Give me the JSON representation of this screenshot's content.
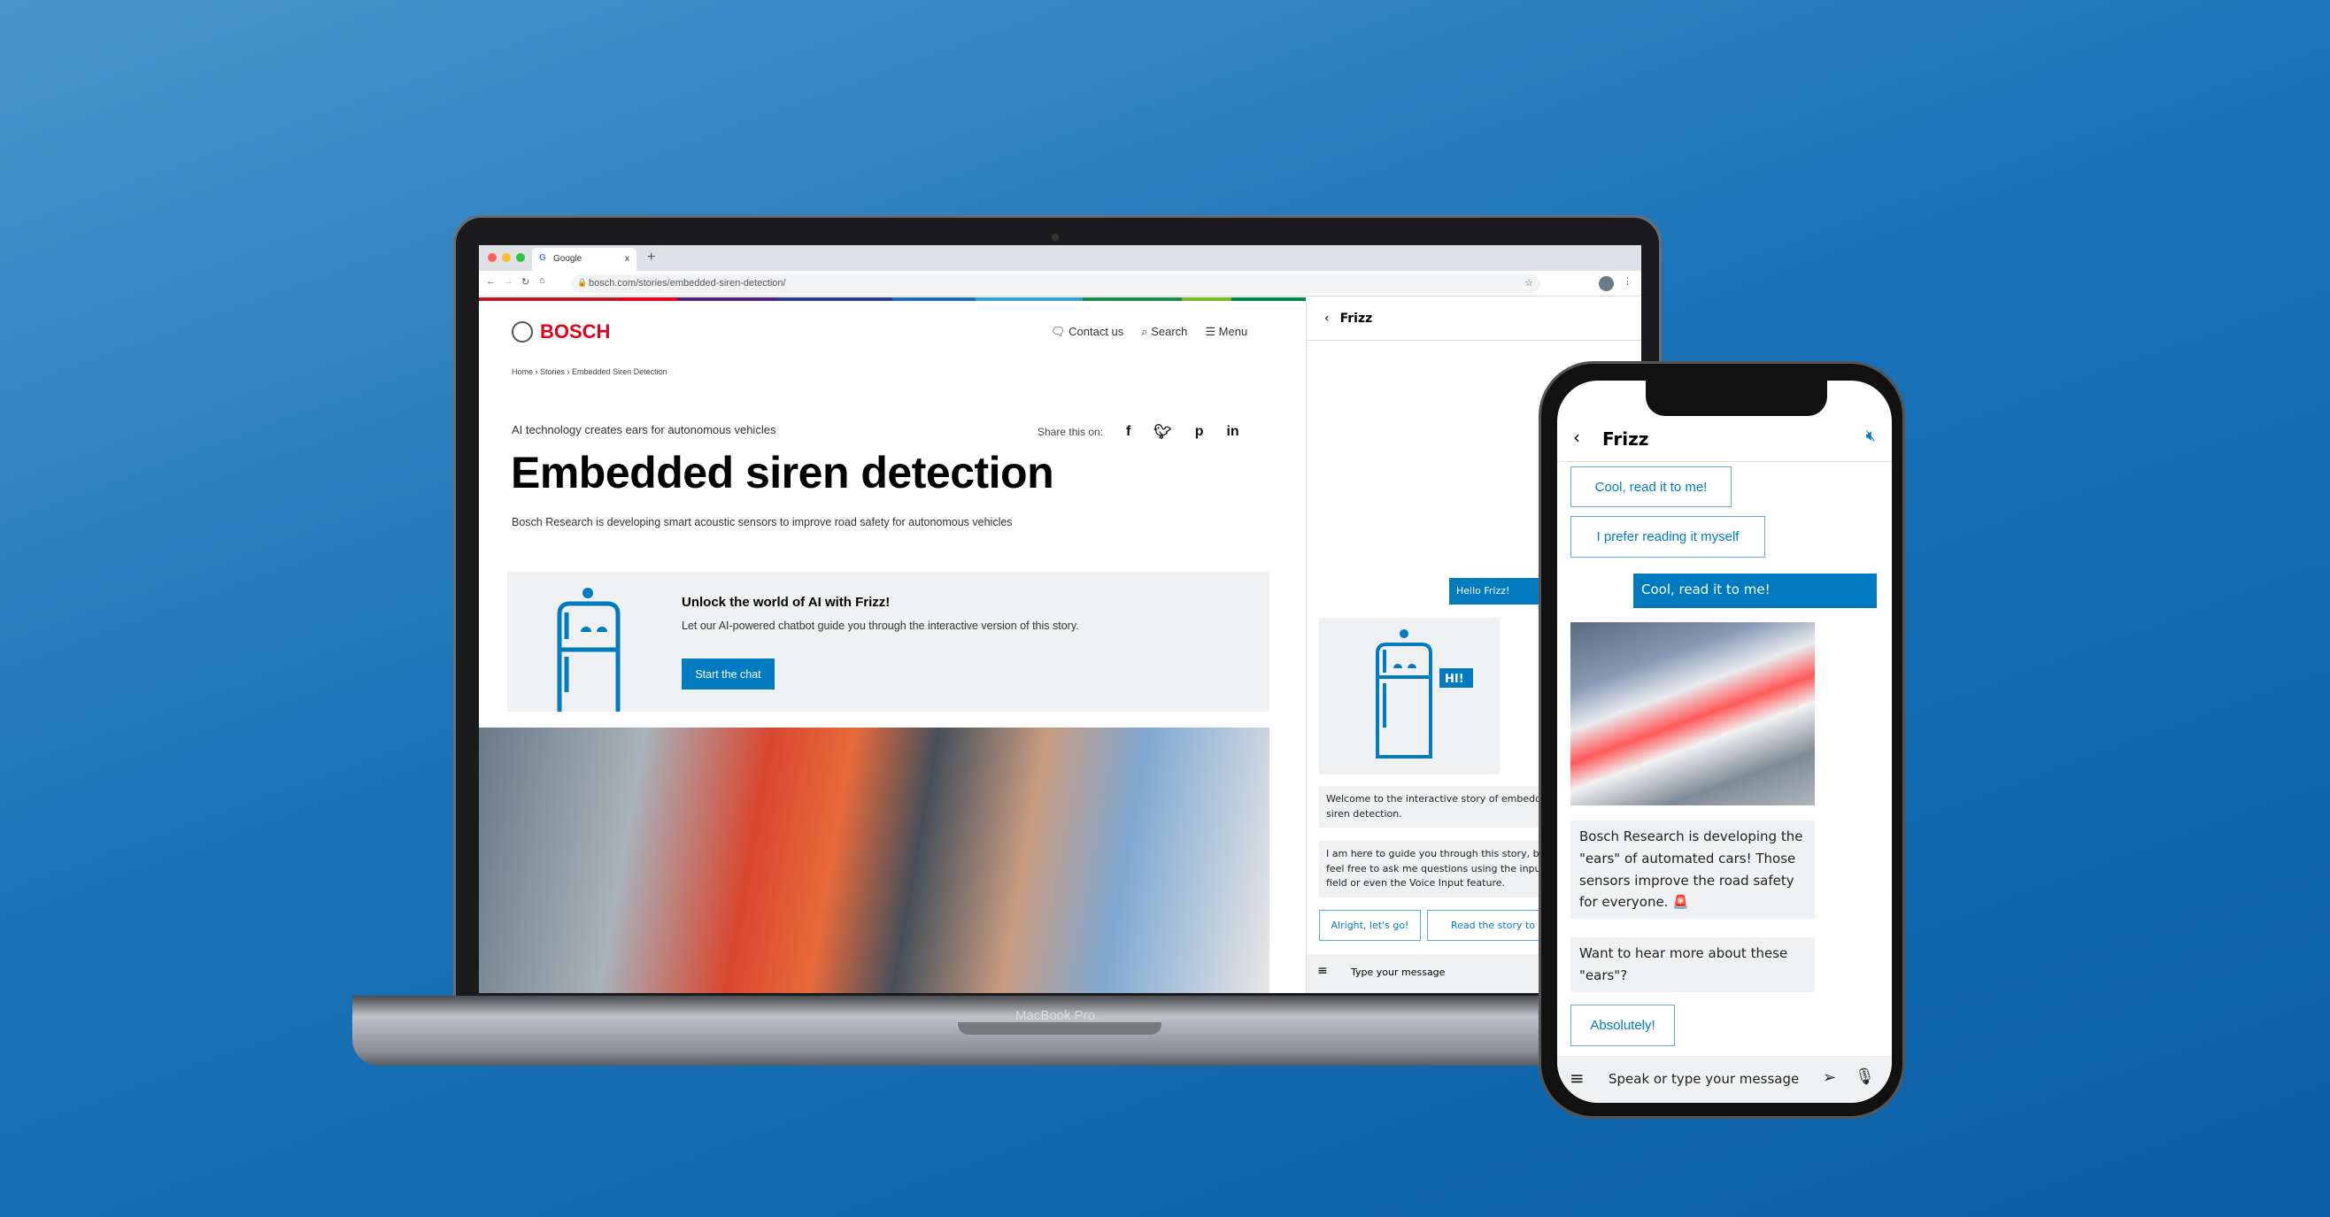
{
  "browser": {
    "tab_title": "Google",
    "tab_close": "x",
    "new_tab": "+",
    "url": "bosch.com/stories/embedded-siren-detection/"
  },
  "site": {
    "logo": "BOSCH",
    "nav": {
      "contact": "Contact us",
      "search": "Search",
      "menu": "Menu"
    },
    "breadcrumb": [
      "Home",
      "Stories",
      "Embedded Siren Detection"
    ],
    "kicker": "AI technology creates ears for autonomous vehicles",
    "share_label": "Share this on:",
    "share_icons": [
      "f",
      "t",
      "p",
      "in"
    ],
    "title": "Embedded siren detection",
    "description": "Bosch Research is developing smart acoustic sensors to improve road safety for autonomous vehicles",
    "promo": {
      "heading": "Unlock the world of AI with Frizz!",
      "text": "Let our AI-powered chatbot guide you through the interactive version of this story.",
      "button": "Start the chat"
    }
  },
  "desktop_chat": {
    "title": "Frizz",
    "user_message": "Hello Frizz!",
    "robot_bubble": "HI!",
    "bot_messages": [
      "Welcome to the interactive story of embedded siren detection.",
      "I am here to guide you through this story, but feel free to ask me questions using the input field or even the Voice Input feature."
    ],
    "options": [
      "Alright, let's go!",
      "Read the story to me"
    ],
    "input_placeholder": "Type your message"
  },
  "laptop_label": "MacBook Pro",
  "phone_chat": {
    "title": "Frizz",
    "options": [
      "Cool, read it to me!",
      "I prefer reading it myself"
    ],
    "user_message": "Cool, read it to me!",
    "bot_messages": [
      "Bosch Research is developing the \"ears\" of automated cars! Those sensors improve the road safety for everyone.",
      "Want to hear more about these \"ears\"?"
    ],
    "reply_option": "Absolutely!",
    "input_placeholder": "Speak or type your message"
  },
  "colors": {
    "brand_red": "#e2001a",
    "accent_blue": "#007bc0",
    "bubble_gray": "#eff1f2"
  }
}
